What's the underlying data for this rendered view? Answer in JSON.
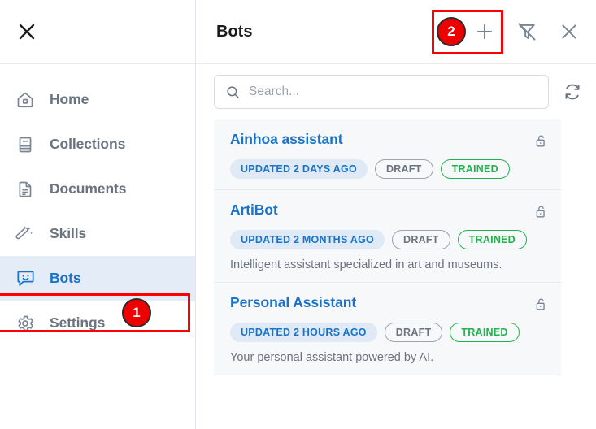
{
  "sidebar": {
    "close_icon": "close-icon",
    "items": [
      {
        "label": "Home",
        "icon": "home-icon",
        "active": false
      },
      {
        "label": "Collections",
        "icon": "collections-icon",
        "active": false
      },
      {
        "label": "Documents",
        "icon": "documents-icon",
        "active": false
      },
      {
        "label": "Skills",
        "icon": "magic-wand-icon",
        "active": false
      },
      {
        "label": "Bots",
        "icon": "chat-bubble-smiley-icon",
        "active": true
      },
      {
        "label": "Settings",
        "icon": "gear-icon",
        "active": false
      }
    ]
  },
  "header": {
    "title": "Bots",
    "actions": [
      {
        "name": "add-bot-button",
        "icon": "plus-icon"
      },
      {
        "name": "filter-off-button",
        "icon": "filter-off-icon"
      },
      {
        "name": "close-panel-button",
        "icon": "close-icon"
      }
    ]
  },
  "search": {
    "placeholder": "Search...",
    "value": "",
    "icon": "search-icon",
    "refresh_icon": "refresh-icon"
  },
  "bots": [
    {
      "name": "Ainhoa assistant",
      "updated": "UPDATED 2 DAYS AGO",
      "status_draft": "DRAFT",
      "status_trained": "TRAINED",
      "description": "",
      "lock_icon": "unlocked-padlock-icon"
    },
    {
      "name": "ArtiBot",
      "updated": "UPDATED 2 MONTHS AGO",
      "status_draft": "DRAFT",
      "status_trained": "TRAINED",
      "description": "Intelligent assistant specialized in art and museums.",
      "lock_icon": "unlocked-padlock-icon"
    },
    {
      "name": "Personal Assistant",
      "updated": "UPDATED 2 HOURS AGO",
      "status_draft": "DRAFT",
      "status_trained": "TRAINED",
      "description": "Your personal assistant powered by AI.",
      "lock_icon": "unlocked-padlock-icon"
    }
  ],
  "annotations": [
    {
      "number": "1",
      "target": "sidebar-item-bots"
    },
    {
      "number": "2",
      "target": "add-bot-button"
    }
  ],
  "colors": {
    "accent_blue": "#1a73c8",
    "trained_green": "#22b24c",
    "draft_gray": "#6b7280",
    "annotation_red": "#ee0000",
    "card_bg": "#f6f8fa",
    "active_nav_bg": "#e4ecf7"
  }
}
